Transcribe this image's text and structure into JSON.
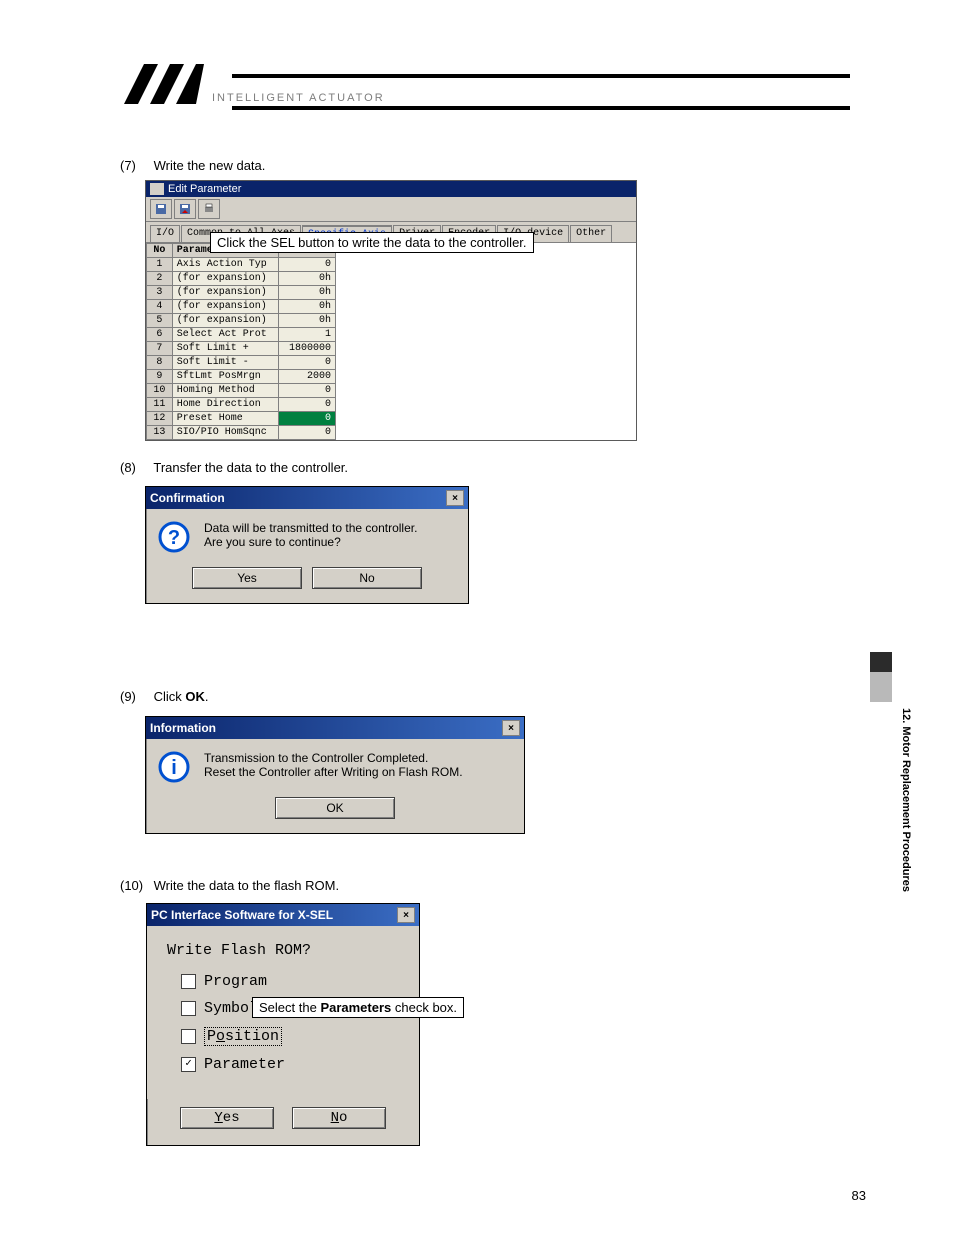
{
  "brand": "INTELLIGENT ACTUATOR",
  "side_section": "12. Motor Replacement Procedures",
  "page_number": "83",
  "step7": {
    "num": "(7)",
    "text": "Write the new data.",
    "callout": "Click the SEL button to write the data to the controller.",
    "window_title": "Edit Parameter",
    "tabs": [
      "I/O",
      "Common to All Axes",
      "Specific Axis",
      "Driver",
      "Encoder",
      "I/O device",
      "Other"
    ],
    "cols": [
      "No",
      "Parame"
    ],
    "rows": [
      {
        "no": "1",
        "name": "Axis Action Typ",
        "val": "0"
      },
      {
        "no": "2",
        "name": "(for expansion)",
        "val": "0h"
      },
      {
        "no": "3",
        "name": "(for expansion)",
        "val": "0h"
      },
      {
        "no": "4",
        "name": "(for expansion)",
        "val": "0h"
      },
      {
        "no": "5",
        "name": "(for expansion)",
        "val": "0h"
      },
      {
        "no": "6",
        "name": "Select Act Prot",
        "val": "1"
      },
      {
        "no": "7",
        "name": "Soft Limit +",
        "val": "1800000"
      },
      {
        "no": "8",
        "name": "Soft Limit -",
        "val": "0"
      },
      {
        "no": "9",
        "name": "SftLmt PosMrgn",
        "val": "2000"
      },
      {
        "no": "10",
        "name": "Homing Method",
        "val": "0"
      },
      {
        "no": "11",
        "name": "Home Direction",
        "val": "0"
      },
      {
        "no": "12",
        "name": "Preset Home",
        "val": "0"
      },
      {
        "no": "13",
        "name": "SIO/PIO HomSqnc",
        "val": "0"
      }
    ]
  },
  "step8": {
    "num": "(8)",
    "text": "Transfer the data to the controller.",
    "title": "Confirmation",
    "msg1": "Data will be transmitted to the controller.",
    "msg2": "Are you sure to continue?",
    "yes": "Yes",
    "no": "No"
  },
  "step9": {
    "num": "(9)",
    "text_pre": "Click ",
    "text_bold": "OK",
    "text_post": ".",
    "title": "Information",
    "msg1": "Transmission to the Controller Completed.",
    "msg2": "Reset the Controller after Writing on Flash ROM.",
    "ok": "OK"
  },
  "step10": {
    "num": "(10)",
    "text": "Write the data to the flash ROM.",
    "title": "PC Interface Software for X-SEL",
    "question": "Write Flash ROM?",
    "opts": {
      "program": {
        "label": "Program",
        "checked": false
      },
      "symbol": {
        "label": "Symbol",
        "checked": false
      },
      "position": {
        "label": "Position",
        "checked": false,
        "dotted": true
      },
      "parameter": {
        "label": "Parameter",
        "checked": true
      }
    },
    "callout_pre": "Select the ",
    "callout_bold": "Parameters",
    "callout_post": " check box.",
    "yes": "Yes",
    "no": "No"
  }
}
